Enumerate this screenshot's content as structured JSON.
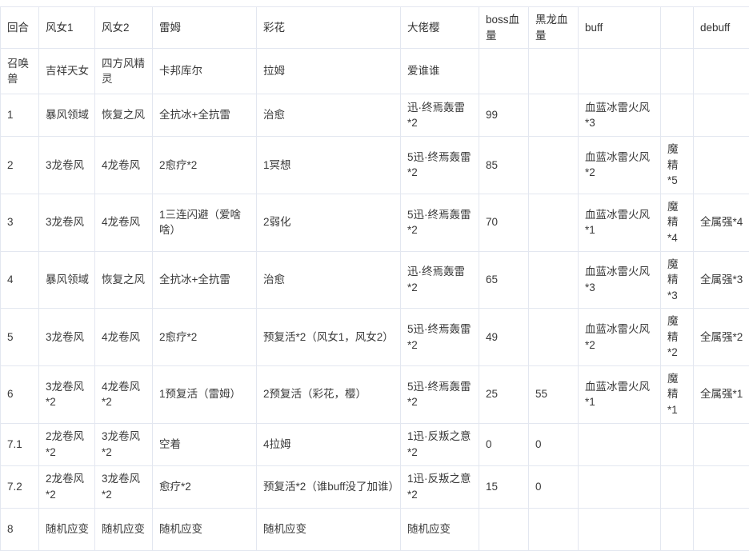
{
  "table": {
    "columns": [
      {
        "key": "round",
        "label": "回合"
      },
      {
        "key": "windgirl1",
        "label": "风女1"
      },
      {
        "key": "windgirl2",
        "label": "风女2"
      },
      {
        "key": "rem",
        "label": "雷姆"
      },
      {
        "key": "caihua",
        "label": "彩花"
      },
      {
        "key": "dalaoying",
        "label": "大佬樱"
      },
      {
        "key": "bosshp",
        "label": "boss血量"
      },
      {
        "key": "blackhp",
        "label": "黑龙血量"
      },
      {
        "key": "buff",
        "label": "buff"
      },
      {
        "key": "buff2",
        "label": ""
      },
      {
        "key": "debuff",
        "label": "debuff"
      }
    ],
    "summon_row": {
      "round": "召唤兽",
      "windgirl1": "吉祥天女",
      "windgirl2": "四方风精灵",
      "rem": "卡邦库尔",
      "caihua": "拉姆",
      "dalaoying": "爱谁谁",
      "bosshp": "",
      "blackhp": "",
      "buff": "",
      "buff2": "",
      "debuff": ""
    },
    "rows": [
      {
        "round": "1",
        "windgirl1": "暴风领域",
        "windgirl2": "恢复之风",
        "rem": "全抗冰+全抗雷",
        "caihua": "治愈",
        "dalaoying": "迅·终焉轰雷*2",
        "bosshp": "99",
        "blackhp": "",
        "buff": "血蓝冰雷火风*3",
        "buff2": "",
        "debuff": ""
      },
      {
        "round": "2",
        "windgirl1": "3龙卷风",
        "windgirl2": "4龙卷风",
        "rem": "2愈疗*2",
        "caihua": "1冥想",
        "dalaoying": "5迅·终焉轰雷*2",
        "bosshp": "85",
        "blackhp": "",
        "buff": "血蓝冰雷火风*2",
        "buff2": "魔精*5",
        "debuff": ""
      },
      {
        "round": "3",
        "windgirl1": "3龙卷风",
        "windgirl2": "4龙卷风",
        "rem": "1三连闪避（爱啥啥）",
        "caihua": "2弱化",
        "dalaoying": "5迅·终焉轰雷*2",
        "bosshp": "70",
        "blackhp": "",
        "buff": "血蓝冰雷火风*1",
        "buff2": "魔精*4",
        "debuff": "全属强*4"
      },
      {
        "round": "4",
        "windgirl1": "暴风领域",
        "windgirl2": "恢复之风",
        "rem": "全抗冰+全抗雷",
        "caihua": "治愈",
        "dalaoying": "迅·终焉轰雷*2",
        "bosshp": "65",
        "blackhp": "",
        "buff": "血蓝冰雷火风*3",
        "buff2": "魔精*3",
        "debuff": "全属强*3"
      },
      {
        "round": "5",
        "windgirl1": "3龙卷风",
        "windgirl2": "4龙卷风",
        "rem": "2愈疗*2",
        "caihua": "预复活*2（风女1，风女2）",
        "dalaoying": "5迅·终焉轰雷*2",
        "bosshp": "49",
        "blackhp": "",
        "buff": "血蓝冰雷火风*2",
        "buff2": "魔精*2",
        "debuff": "全属强*2"
      },
      {
        "round": "6",
        "windgirl1": "3龙卷风*2",
        "windgirl2": "4龙卷风*2",
        "rem": "1预复活（雷姆）",
        "caihua": "2预复活（彩花，樱）",
        "dalaoying": "5迅·终焉轰雷*2",
        "bosshp": "25",
        "blackhp": "55",
        "buff": "血蓝冰雷火风*1",
        "buff2": "魔精*1",
        "debuff": "全属强*1"
      },
      {
        "round": "7.1",
        "windgirl1": "2龙卷风*2",
        "windgirl2": "3龙卷风*2",
        "rem": "空着",
        "caihua": "4拉姆",
        "dalaoying": "1迅·反叛之意*2",
        "bosshp": "0",
        "blackhp": "0",
        "buff": "",
        "buff2": "",
        "debuff": ""
      },
      {
        "round": "7.2",
        "windgirl1": "2龙卷风*2",
        "windgirl2": "3龙卷风*2",
        "rem": "愈疗*2",
        "caihua": "预复活*2（谁buff没了加谁）",
        "dalaoying": "1迅·反叛之意*2",
        "bosshp": "15",
        "blackhp": "0",
        "buff": "",
        "buff2": "",
        "debuff": ""
      },
      {
        "round": "8",
        "windgirl1": "随机应变",
        "windgirl2": "随机应变",
        "rem": "随机应变",
        "caihua": "随机应变",
        "dalaoying": "随机应变",
        "bosshp": "",
        "blackhp": "",
        "buff": "",
        "buff2": "",
        "debuff": ""
      }
    ]
  }
}
